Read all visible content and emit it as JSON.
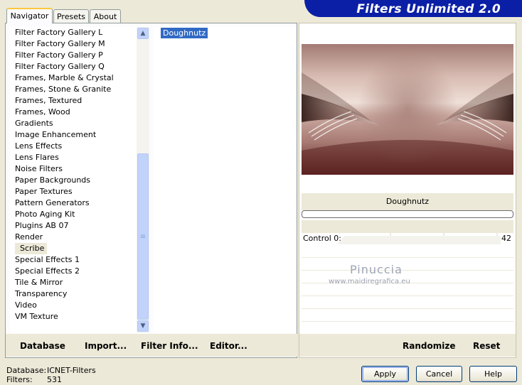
{
  "app": {
    "title": "Filters Unlimited 2.0"
  },
  "tabs": [
    {
      "label": "Navigator",
      "active": true
    },
    {
      "label": "Presets",
      "active": false
    },
    {
      "label": "About",
      "active": false
    }
  ],
  "categories": [
    "Filter Factory Gallery L",
    "Filter Factory Gallery M",
    "Filter Factory Gallery P",
    "Filter Factory Gallery Q",
    "Frames, Marble & Crystal",
    "Frames, Stone & Granite",
    "Frames, Textured",
    "Frames, Wood",
    "Gradients",
    "Image Enhancement",
    "Lens Effects",
    "Lens Flares",
    "Noise Filters",
    "Paper Backgrounds",
    "Paper Textures",
    "Pattern Generators",
    "Photo Aging Kit",
    "Plugins AB 07",
    "Render",
    "Scribe",
    "Special Effects 1",
    "Special Effects 2",
    "Tile & Mirror",
    "Transparency",
    "Video",
    "VM Texture"
  ],
  "selected_category": "Scribe",
  "filters": [
    "Doughnutz"
  ],
  "selected_filter": "Doughnutz",
  "preview": {
    "filter_name": "Doughnutz"
  },
  "controls": [
    {
      "label": "Control 0:",
      "value": "42"
    }
  ],
  "watermark": {
    "name": "Pinuccia",
    "url": "www.maidiregrafica.eu"
  },
  "left_toolbar": {
    "database": "Database",
    "import": "Import...",
    "filter_info": "Filter Info...",
    "editor": "Editor..."
  },
  "right_toolbar": {
    "randomize": "Randomize",
    "reset": "Reset"
  },
  "status": {
    "database_label": "Database:",
    "database_value": "ICNET-Filters",
    "filters_label": "Filters:",
    "filters_value": "531"
  },
  "buttons": {
    "apply": "Apply",
    "cancel": "Cancel",
    "help": "Help"
  },
  "colors": {
    "banner": "#0b1fa6",
    "selection": "#316ac5",
    "face": "#ece9d8",
    "tab_highlight": "#ffc83c"
  }
}
